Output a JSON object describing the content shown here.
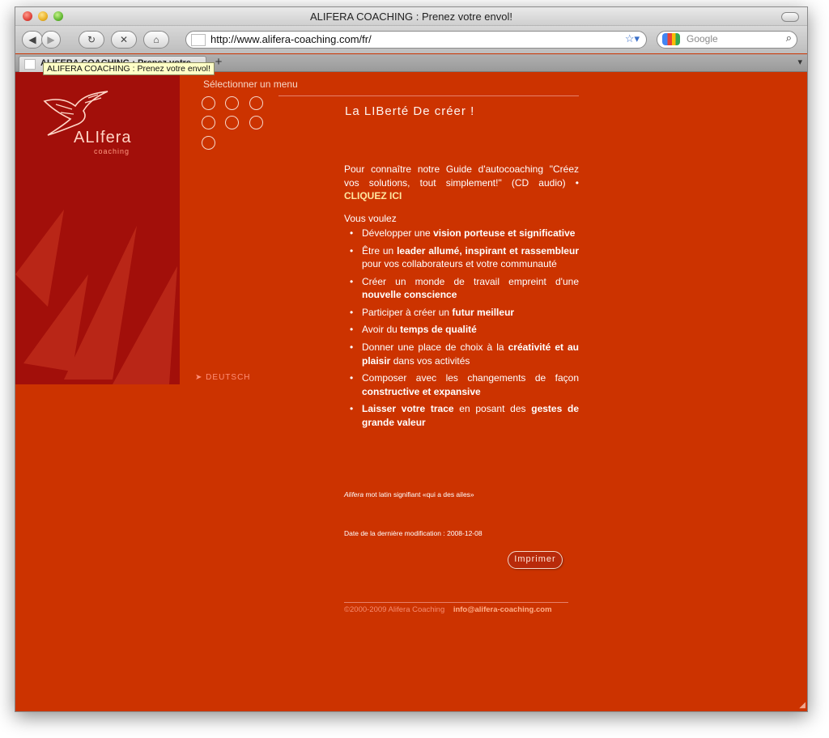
{
  "window": {
    "title": "ALIFERA COACHING : Prenez votre envol!"
  },
  "toolbar": {
    "back_icon": "back-arrow-icon",
    "forward_icon": "forward-arrow-icon",
    "reload_icon": "reload-icon",
    "stop_icon": "stop-icon",
    "home_icon": "home-icon",
    "url": "http://www.alifera-coaching.com/fr/",
    "search_placeholder": "Google"
  },
  "tabs": [
    {
      "label": "ALIFERA COACHING : Prenez votre..."
    }
  ],
  "tooltip": "ALIFERA COACHING : Prenez votre envol!",
  "site": {
    "logo_name": "ALIfera",
    "logo_sub": "coaching",
    "menu_label": "Sélectionner un menu",
    "language_link": "DEUTSCH",
    "heading": "La LIBerté De créer !",
    "intro_text": "Pour connaître notre Guide d'autocoaching \"Créez vos solutions, tout simplement!\" (CD audio) •",
    "intro_cta": "CLIQUEZ ICI",
    "vous_voulez": "Vous voulez",
    "items": [
      {
        "a": "Développer une ",
        "b": "vision porteuse et significative",
        "c": ""
      },
      {
        "a": "Être un ",
        "b": "leader allumé, inspirant et rassembleur",
        "c": " pour vos collaborateurs et votre communauté"
      },
      {
        "a": "Créer un monde de travail empreint d'une ",
        "b": "nouvelle conscience",
        "c": ""
      },
      {
        "a": "Participer à créer un ",
        "b": "futur meilleur",
        "c": ""
      },
      {
        "a": "Avoir du ",
        "b": "temps de qualité",
        "c": ""
      },
      {
        "a": "Donner une place de choix à la ",
        "b": "créativité et au plaisir",
        "c": " dans vos activités"
      },
      {
        "a": "Composer avec les changements de façon ",
        "b": "constructive et expansive",
        "c": ""
      },
      {
        "a": "",
        "b": "Laisser votre trace",
        "c": " en posant des "
      },
      {
        "a": "",
        "b": "gestes de grande valeur",
        "c": ""
      }
    ],
    "alifera_word": "Alifera",
    "alifera_meaning": " mot latin signifiant «qui a des ailes»",
    "last_modified": "Date de la dernière modification : 2008-12-08",
    "print_label": "Imprimer",
    "copyright": "©2000-2009 Alifera Coaching",
    "email": "info@alifera-coaching.com"
  },
  "colors": {
    "page_bg": "#cc3300",
    "sidebar_bg": "#a20f0a",
    "accent": "#ffe7a0"
  }
}
